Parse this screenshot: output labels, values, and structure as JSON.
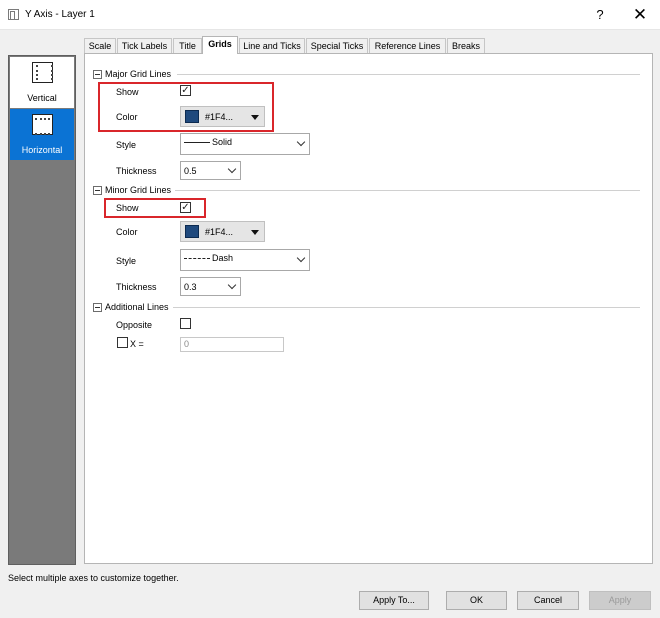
{
  "window": {
    "title": "Y Axis - Layer 1",
    "help": "?",
    "close": "✕"
  },
  "sidebar": {
    "items": [
      {
        "label": "Vertical",
        "icon": "vertical-grid-icon",
        "selected": false
      },
      {
        "label": "Horizontal",
        "icon": "horizontal-grid-icon",
        "selected": true
      }
    ]
  },
  "tabs": [
    {
      "label": "Scale"
    },
    {
      "label": "Tick Labels"
    },
    {
      "label": "Title"
    },
    {
      "label": "Grids",
      "active": true
    },
    {
      "label": "Line and Ticks"
    },
    {
      "label": "Special Ticks"
    },
    {
      "label": "Reference Lines"
    },
    {
      "label": "Breaks"
    }
  ],
  "major": {
    "heading": "Major Grid Lines",
    "show_label": "Show",
    "show_checked": true,
    "color_label": "Color",
    "color_value": "#1F4...",
    "color_hex": "#1F497D",
    "style_label": "Style",
    "style_value": "Solid",
    "style_sample": "solid",
    "thickness_label": "Thickness",
    "thickness_value": "0.5"
  },
  "minor": {
    "heading": "Minor Grid Lines",
    "show_label": "Show",
    "show_checked": true,
    "color_label": "Color",
    "color_value": "#1F4...",
    "color_hex": "#1F497D",
    "style_label": "Style",
    "style_value": "Dash",
    "style_sample": "dash",
    "thickness_label": "Thickness",
    "thickness_value": "0.3"
  },
  "additional": {
    "heading": "Additional Lines",
    "opposite_label": "Opposite",
    "opposite_checked": false,
    "x_label": "X =",
    "x_checked": false,
    "x_value": "0"
  },
  "footer": {
    "hint": "Select multiple axes to customize together.",
    "apply_to": "Apply To...",
    "ok": "OK",
    "cancel": "Cancel",
    "apply": "Apply"
  },
  "colors": {
    "highlight": "#d9262b",
    "selection": "#0b73d4",
    "grid_color": "#1F497D"
  }
}
